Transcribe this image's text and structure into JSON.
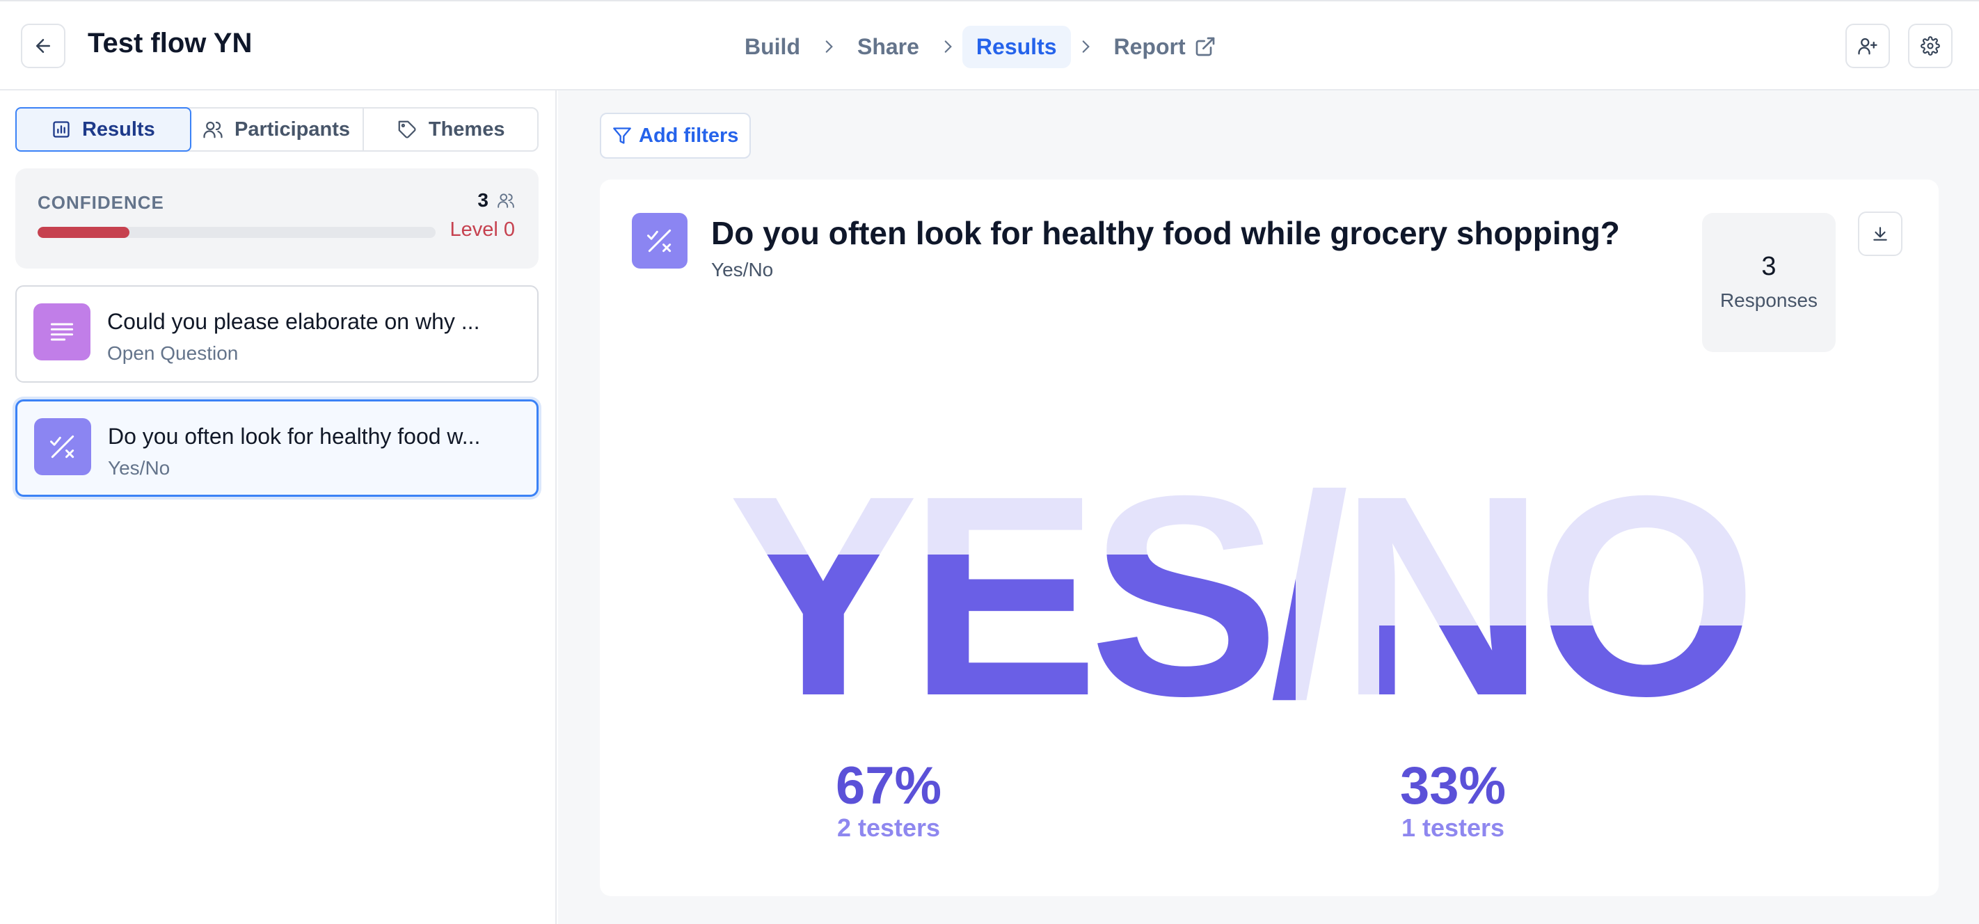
{
  "header": {
    "title": "Test flow YN",
    "steps": [
      {
        "label": "Build"
      },
      {
        "label": "Share"
      },
      {
        "label": "Results"
      },
      {
        "label": "Report"
      }
    ]
  },
  "sidebar": {
    "tabs": [
      {
        "label": "Results",
        "icon": "bar-chart-icon"
      },
      {
        "label": "Participants",
        "icon": "users-icon"
      },
      {
        "label": "Themes",
        "icon": "tag-icon"
      }
    ],
    "confidence": {
      "label": "CONFIDENCE",
      "count": "3",
      "level": "Level 0",
      "progress": 0.23,
      "color": "#c6414f"
    },
    "questions": [
      {
        "title": "Could you please elaborate on why ...",
        "type": "Open Question",
        "icon": "text-lines-icon",
        "color": "#c17ee8"
      },
      {
        "title": "Do you often look for healthy food w...",
        "type": "Yes/No",
        "icon": "check-x-icon",
        "color": "#8b85f2"
      }
    ]
  },
  "main": {
    "filters_label": "Add filters",
    "card": {
      "title": "Do you often look for healthy food while grocery shopping?",
      "type": "Yes/No",
      "responses_count": "3",
      "responses_label": "Responses",
      "word": "YES/NO",
      "yes": {
        "percent": "67%",
        "testers": "2 testers",
        "fraction": 0.67
      },
      "no": {
        "percent": "33%",
        "testers": "1 testers",
        "fraction": 0.33
      },
      "colors": {
        "fill": "#6a5fe6",
        "light": "#e4e3fb",
        "text": "#5b51d8",
        "subtext": "#8e87ef"
      }
    }
  }
}
